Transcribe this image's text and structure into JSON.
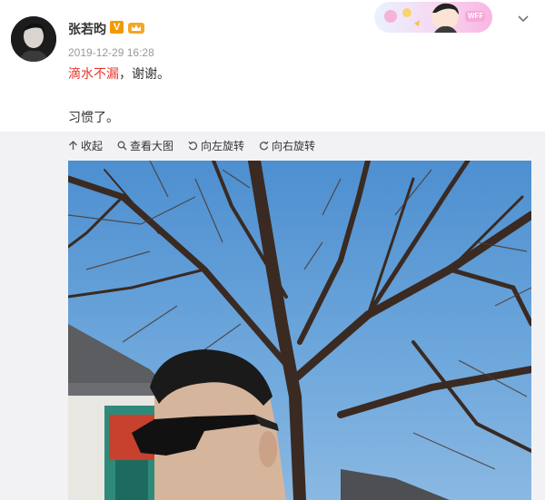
{
  "post": {
    "username": "张若昀",
    "verified_badge": "V",
    "timestamp": "2019-12-29 16:28",
    "text_highlight": "滴水不漏",
    "text_rest": "，谢谢。",
    "text_line2": "习惯了。"
  },
  "toolbar": {
    "collapse_label": "收起",
    "view_large_label": "查看大图",
    "rotate_left_label": "向左旋转",
    "rotate_right_label": "向右旋转"
  },
  "banner": {
    "badge_text": "WFF"
  },
  "colors": {
    "highlight": "#e8362e",
    "badge": "#f39800",
    "sky": "#5e9ed6",
    "toolbar_bg": "#f2f2f5"
  },
  "icons": [
    "crown-icon",
    "chevron-down-icon",
    "collapse-icon",
    "zoom-icon",
    "rotate-left-icon",
    "rotate-right-icon"
  ]
}
